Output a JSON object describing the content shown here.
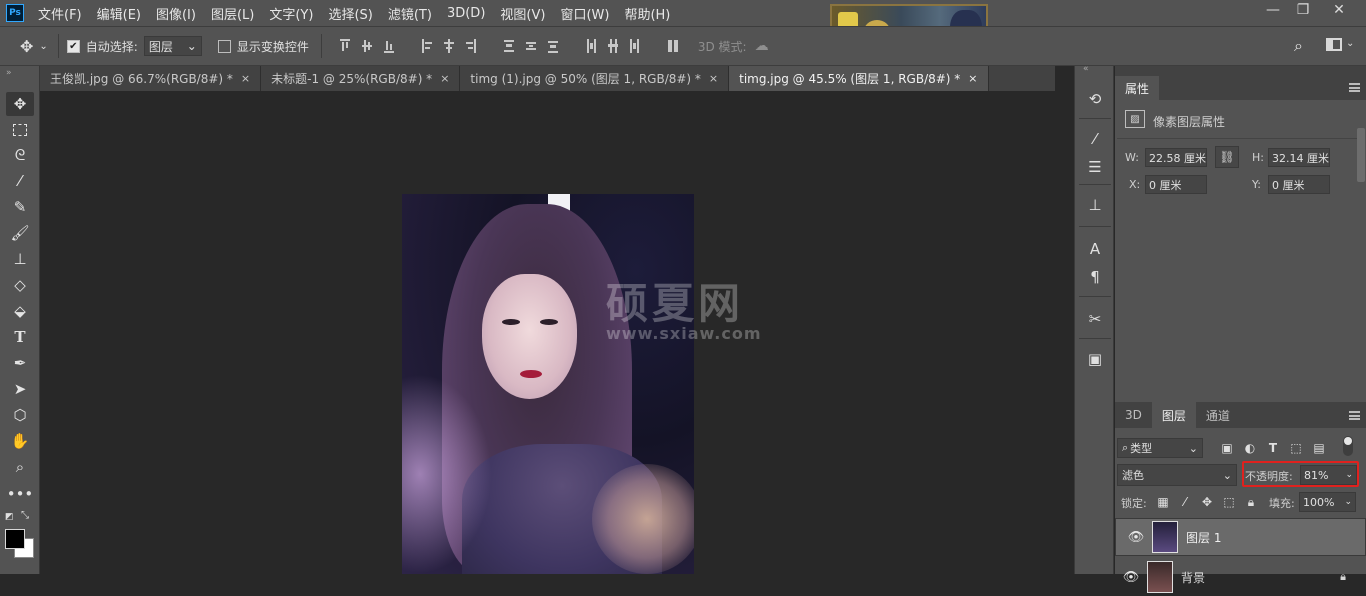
{
  "app": {
    "logo": "Ps"
  },
  "menu": [
    "文件(F)",
    "编辑(E)",
    "图像(I)",
    "图层(L)",
    "文字(Y)",
    "选择(S)",
    "滤镜(T)",
    "3D(D)",
    "视图(V)",
    "窗口(W)",
    "帮助(H)"
  ],
  "window_controls": {
    "minimize": "—",
    "restore": "❐",
    "close": "✕"
  },
  "options": {
    "move_icon": "move-icon",
    "auto_select_label": "自动选择:",
    "auto_select_checked": true,
    "auto_select_target": "图层",
    "show_transform_label": "显示变换控件",
    "show_transform_checked": false,
    "mode_3d_label": "3D 模式:"
  },
  "tabs": [
    {
      "label": "王俊凯.jpg @ 66.7%(RGB/8#) *",
      "close": "×",
      "active": false
    },
    {
      "label": "未标题-1 @ 25%(RGB/8#) *",
      "close": "×",
      "active": false
    },
    {
      "label": "timg (1).jpg @ 50% (图层 1, RGB/8#) *",
      "close": "×",
      "active": false
    },
    {
      "label": "timg.jpg @ 45.5% (图层 1, RGB/8#) *",
      "close": "×",
      "active": true
    }
  ],
  "tools": [
    "move",
    "rect-marquee",
    "lasso",
    "magic-wand",
    "eyedropper",
    "brush",
    "clone-stamp",
    "eraser",
    "paint-bucket",
    "type",
    "pen",
    "path-select",
    "shape",
    "hand",
    "zoom",
    "more"
  ],
  "watermark": {
    "line1": "硕夏网",
    "line2": "www.sxiaw.com"
  },
  "properties": {
    "tab": "属性",
    "section": "像素图层属性",
    "w_label": "W:",
    "w_value": "22.58 厘米",
    "h_label": "H:",
    "h_value": "32.14 厘米",
    "x_label": "X:",
    "x_value": "0 厘米",
    "y_label": "Y:",
    "y_value": "0 厘米"
  },
  "layers_panel": {
    "tabs": [
      "3D",
      "图层",
      "通道"
    ],
    "active_tab": "图层",
    "filter_kind": "类型",
    "blend_mode": "滤色",
    "opacity_label": "不透明度:",
    "opacity_value": "81%",
    "lock_label": "锁定:",
    "fill_label": "填充:",
    "fill_value": "100%",
    "layers": [
      {
        "name": "图层 1",
        "selected": true
      },
      {
        "name": "背景",
        "selected": false
      }
    ]
  },
  "colors": {
    "highlight_box": "#e0211e",
    "foreground": "#000000",
    "background": "#ffffff"
  }
}
